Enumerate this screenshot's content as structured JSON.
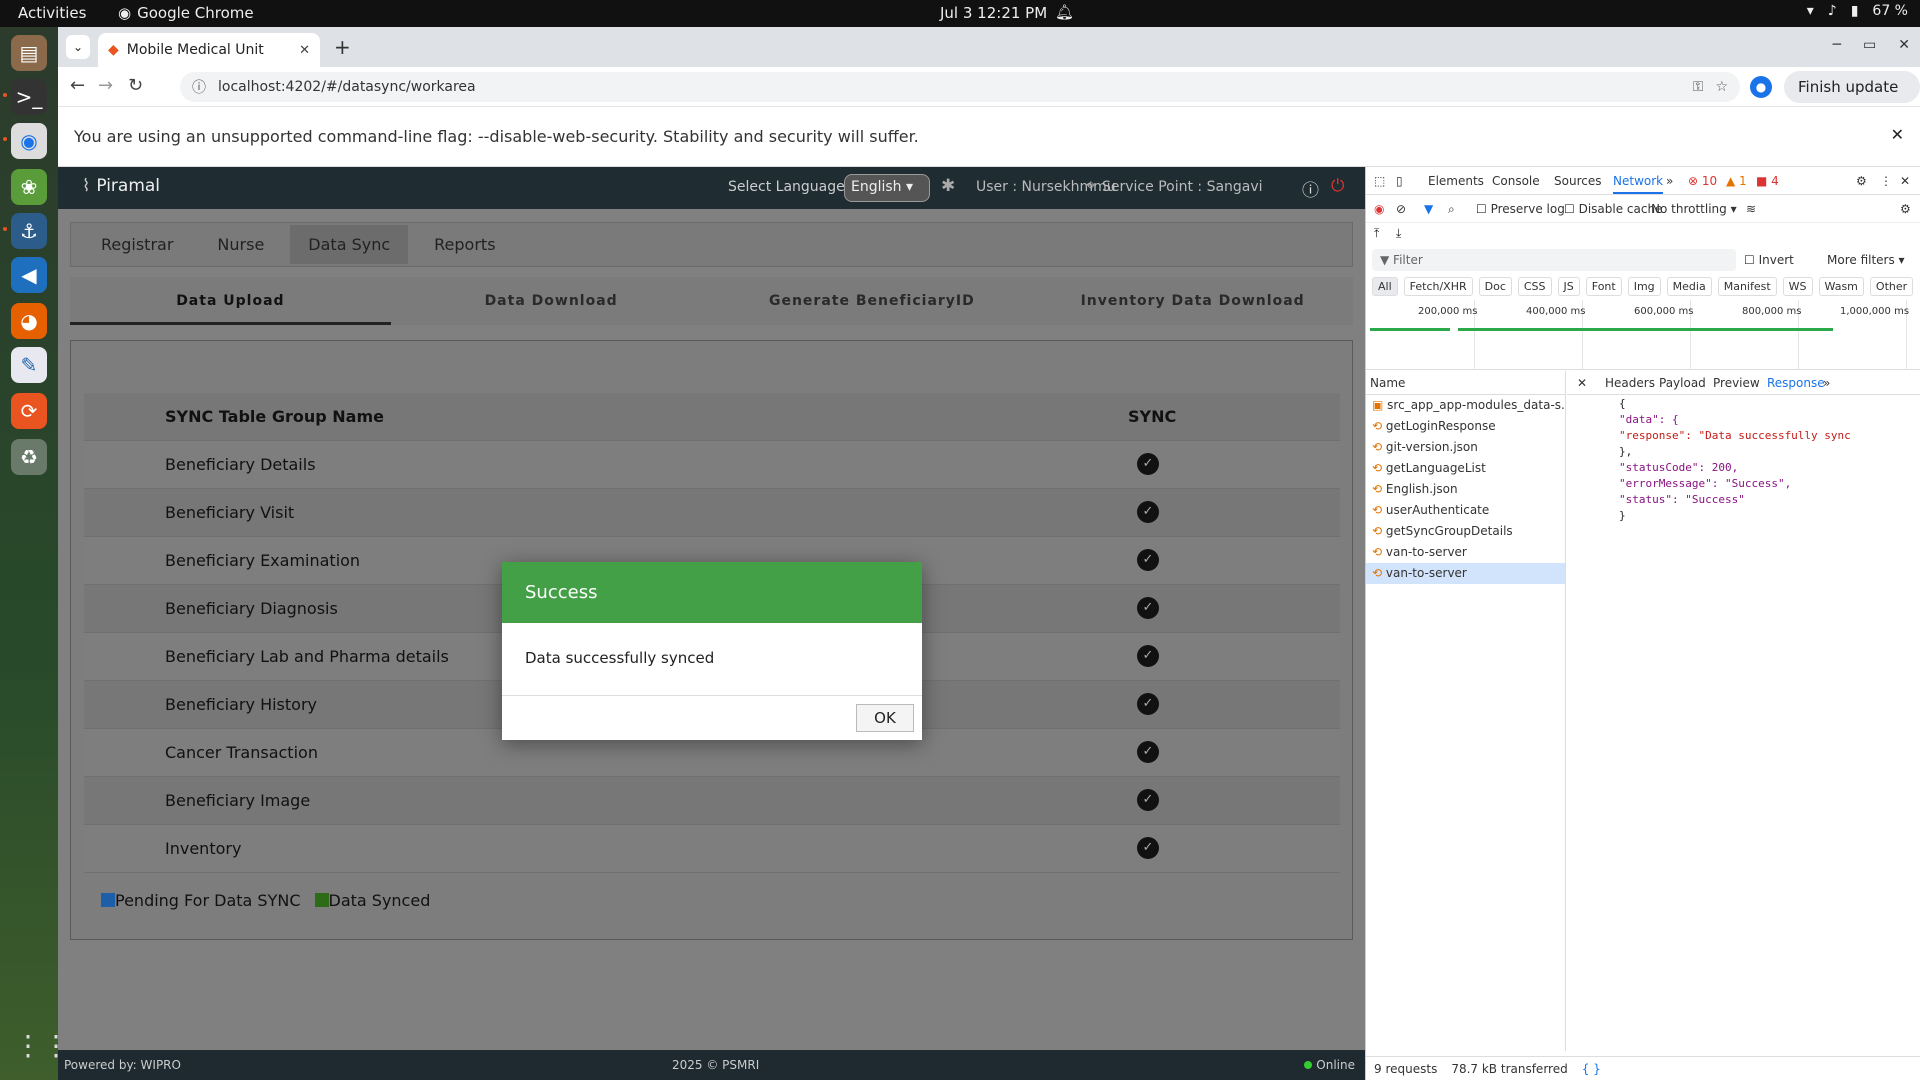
{
  "system": {
    "activities": "Activities",
    "app_name": "Google Chrome",
    "clock": "Jul 3  12:21 PM",
    "battery": "67 %"
  },
  "browser": {
    "tab_title": "Mobile Medical Unit",
    "url": "localhost:4202/#/datasync/workarea",
    "finish_update": "Finish update",
    "infobar": "You are using an unsupported command-line flag: --disable-web-security. Stability and security will suffer."
  },
  "app": {
    "logo": "Piramal",
    "language_label": "Select Language:",
    "language_value": "English",
    "user": "User : Nursekhmmu",
    "service_point": "Service Point : Sangavi",
    "menu": [
      "Registrar",
      "Nurse",
      "Data Sync",
      "Reports"
    ],
    "active_menu": "Data Sync",
    "subtabs": [
      "Data Upload",
      "Data Download",
      "Generate BeneficiaryID",
      "Inventory Data Download"
    ],
    "table": {
      "col1": "SYNC Table Group Name",
      "col2": "SYNC",
      "rows": [
        "Beneficiary Details",
        "Beneficiary Visit",
        "Beneficiary Examination",
        "Beneficiary Diagnosis",
        "Beneficiary Lab and Pharma details",
        "Beneficiary History",
        "Cancer Transaction",
        "Beneficiary Image",
        "Inventory"
      ]
    },
    "legend": {
      "pending": "Pending For Data SYNC",
      "synced": "Data Synced",
      "pending_color": "#1c5fa8",
      "synced_color": "#2e6b16"
    },
    "footer": {
      "left": "Powered by: WIPRO",
      "center": "2025 © PSMRI",
      "right": "Online"
    }
  },
  "modal": {
    "title": "Success",
    "message": "Data successfully synced",
    "ok": "OK",
    "header_color": "#43a047"
  },
  "devtools": {
    "tabs": [
      "Elements",
      "Console",
      "Sources",
      "Network"
    ],
    "active_tab": "Network",
    "errors": "10",
    "warnings": "1",
    "issues": "4",
    "preserve_log": "Preserve log",
    "disable_cache": "Disable cache",
    "throttling": "No throttling",
    "filter_placeholder": "Filter",
    "invert": "Invert",
    "more_filters": "More filters",
    "types": [
      "All",
      "Fetch/XHR",
      "Doc",
      "CSS",
      "JS",
      "Font",
      "Img",
      "Media",
      "Manifest",
      "WS",
      "Wasm",
      "Other"
    ],
    "timeline_ticks": [
      "200,000 ms",
      "400,000 ms",
      "600,000 ms",
      "800,000 ms",
      "1,000,000 ms"
    ],
    "name_header": "Name",
    "requests": [
      "src_app_app-modules_data-s...",
      "getLoginResponse",
      "git-version.json",
      "getLanguageList",
      "English.json",
      "userAuthenticate",
      "getSyncGroupDetails",
      "van-to-server",
      "van-to-server"
    ],
    "resp_tabs": [
      "Headers",
      "Payload",
      "Preview",
      "Response"
    ],
    "active_resp_tab": "Response",
    "response_lines": [
      "{",
      "  \"data\": {",
      "    \"response\": \"Data successfully sync",
      "  },",
      "  \"statusCode\": 200,",
      "  \"errorMessage\": \"Success\",",
      "  \"status\": \"Success\"",
      "}"
    ],
    "status_requests": "9 requests",
    "status_transferred": "78.7 kB transferred"
  }
}
